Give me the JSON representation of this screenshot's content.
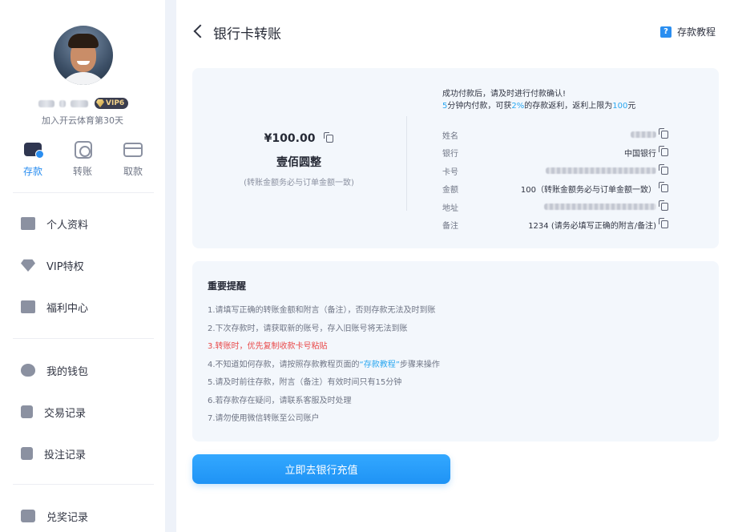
{
  "sidebar": {
    "user": {
      "name_masked": true,
      "vip_label": "VIP6",
      "join_text": "加入开云体育第30天"
    },
    "quick_actions": [
      {
        "label": "存款",
        "icon": "wallet-icon",
        "active": true
      },
      {
        "label": "转账",
        "icon": "transfer-icon",
        "active": false
      },
      {
        "label": "取款",
        "icon": "card-icon",
        "active": false
      }
    ],
    "menu": [
      {
        "label": "个人资料",
        "icon": "id-card-icon"
      },
      {
        "label": "VIP特权",
        "icon": "diamond-icon"
      },
      {
        "label": "福利中心",
        "icon": "gift-icon"
      },
      {
        "label": "我的钱包",
        "icon": "piggy-bank-icon"
      },
      {
        "label": "交易记录",
        "icon": "document-icon"
      },
      {
        "label": "投注记录",
        "icon": "document-icon"
      },
      {
        "label": "兑奖记录",
        "icon": "ticket-icon"
      }
    ]
  },
  "header": {
    "title": "银行卡转账",
    "tutorial_label": "存款教程",
    "tutorial_icon_glyph": "?"
  },
  "amount_panel": {
    "amount": "¥100.00",
    "amount_words": "壹佰圆整",
    "amount_note": "(转账金额务必与订单金额一致)",
    "tip_line1": "成功付款后，请及时进行付款确认!",
    "tip_line2": {
      "minutes": "5",
      "part_a": "分钟内付款，可获",
      "rate": "2%",
      "part_b": "的存款返利，返利上限为",
      "cap": "100",
      "part_c": "元"
    },
    "rows": [
      {
        "key": "姓名",
        "value": ""
      },
      {
        "key": "银行",
        "value": "中国银行"
      },
      {
        "key": "卡号",
        "value": ""
      },
      {
        "key": "金额",
        "value": "100（转账金额务必与订单金额一致）"
      },
      {
        "key": "地址",
        "value": ""
      },
      {
        "key": "备注",
        "value": "1234 (请务必填写正确的附言/备注)"
      }
    ]
  },
  "notice": {
    "title": "重要提醒",
    "lines": [
      "1.请填写正确的转账金额和附言（备注），否则存款无法及时到账",
      "2.下次存款时，请获取新的账号，存入旧账号将无法到账",
      "3.转账时，优先复制收款卡号粘贴",
      "4.不知道如何存款，请按照存款教程页面的",
      "5.请及时前往存款，附言（备注）有效时间只有15分钟",
      "6.若存款存在疑问，请联系客服及时处理",
      "7.请勿使用微信转账至公司账户"
    ],
    "line4_link": "“存款教程”",
    "line4_suffix": "步骤来操作"
  },
  "cta_label": "立即去银行充值",
  "colors": {
    "accent": "#2a8ef0",
    "highlight": "#2aa7f0",
    "warning": "#e94b4b",
    "panel_bg": "#f3f7fc"
  }
}
